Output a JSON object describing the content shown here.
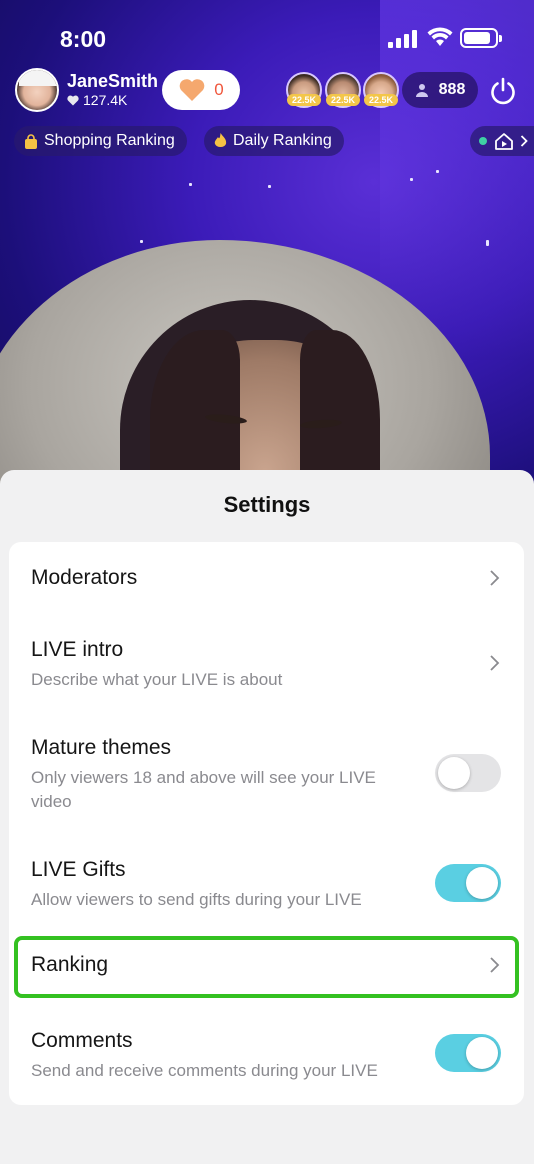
{
  "status_bar": {
    "time": "8:00"
  },
  "host": {
    "name": "JaneSmith",
    "likes": "127.4K",
    "like_button_count": "0"
  },
  "top_viewers": [
    {
      "badge": "22.5K"
    },
    {
      "badge": "22.5K"
    },
    {
      "badge": "22.5K"
    }
  ],
  "viewer_count": "888",
  "ranking_pills": [
    {
      "label": "Shopping Ranking"
    },
    {
      "label": "Daily Ranking"
    }
  ],
  "settings": {
    "title": "Settings",
    "rows": [
      {
        "title": "Moderators",
        "subtitle": "",
        "control": "chevron"
      },
      {
        "title": "LIVE intro",
        "subtitle": "Describe what your LIVE is about",
        "control": "chevron"
      },
      {
        "title": "Mature themes",
        "subtitle": "Only viewers 18 and above will see your LIVE video",
        "control": "toggle",
        "on": false
      },
      {
        "title": "LIVE Gifts",
        "subtitle": "Allow viewers to send gifts during your LIVE",
        "control": "toggle",
        "on": true
      },
      {
        "title": "Ranking",
        "subtitle": "",
        "control": "chevron",
        "highlighted": true
      },
      {
        "title": "Comments",
        "subtitle": "Send and receive comments during your LIVE",
        "control": "toggle",
        "on": true
      }
    ]
  },
  "colors": {
    "toggle_on": "#5acfe2",
    "toggle_off": "#e4e4e6",
    "highlight": "#34c121",
    "like_count": "#f0563c"
  }
}
